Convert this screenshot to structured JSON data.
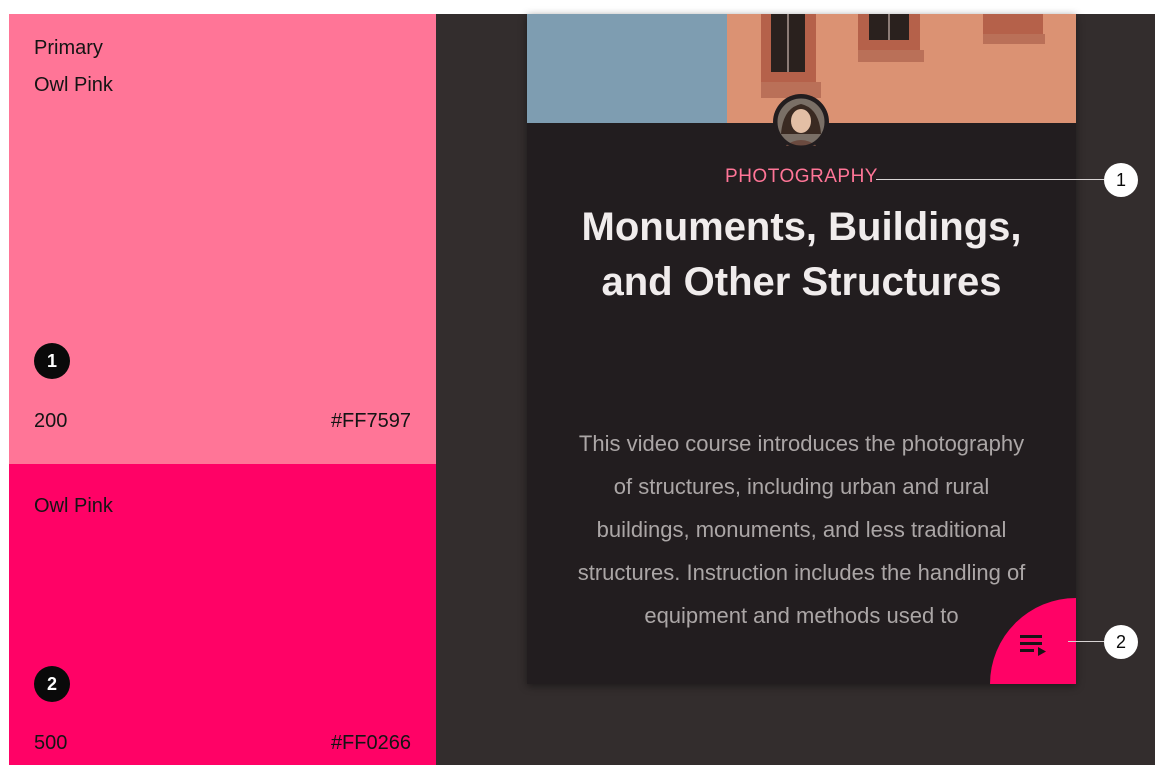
{
  "swatches": [
    {
      "label_line1": "Primary",
      "label_line2": "Owl Pink",
      "marker": "1",
      "weight": "200",
      "hex": "#FF7597"
    },
    {
      "label_line1": "Owl Pink",
      "marker": "2",
      "weight": "500",
      "hex": "#FF0266"
    }
  ],
  "card": {
    "eyebrow": "PHOTOGRAPHY",
    "title": "Monuments, Buildings, and Other Structures",
    "body": "This video course introduces the photography of structures, including urban and rural buildings, monuments, and less traditional structures. Instruction includes the handling of equipment and methods used to"
  },
  "callouts": [
    "1",
    "2"
  ],
  "icons": {
    "fab": "playlist-play-icon",
    "avatar": "avatar-photo"
  },
  "colors": {
    "owl_pink_200": "#FF7597",
    "owl_pink_500": "#FF0266",
    "background": "#332D2D",
    "card_surface": "#221D1F"
  }
}
